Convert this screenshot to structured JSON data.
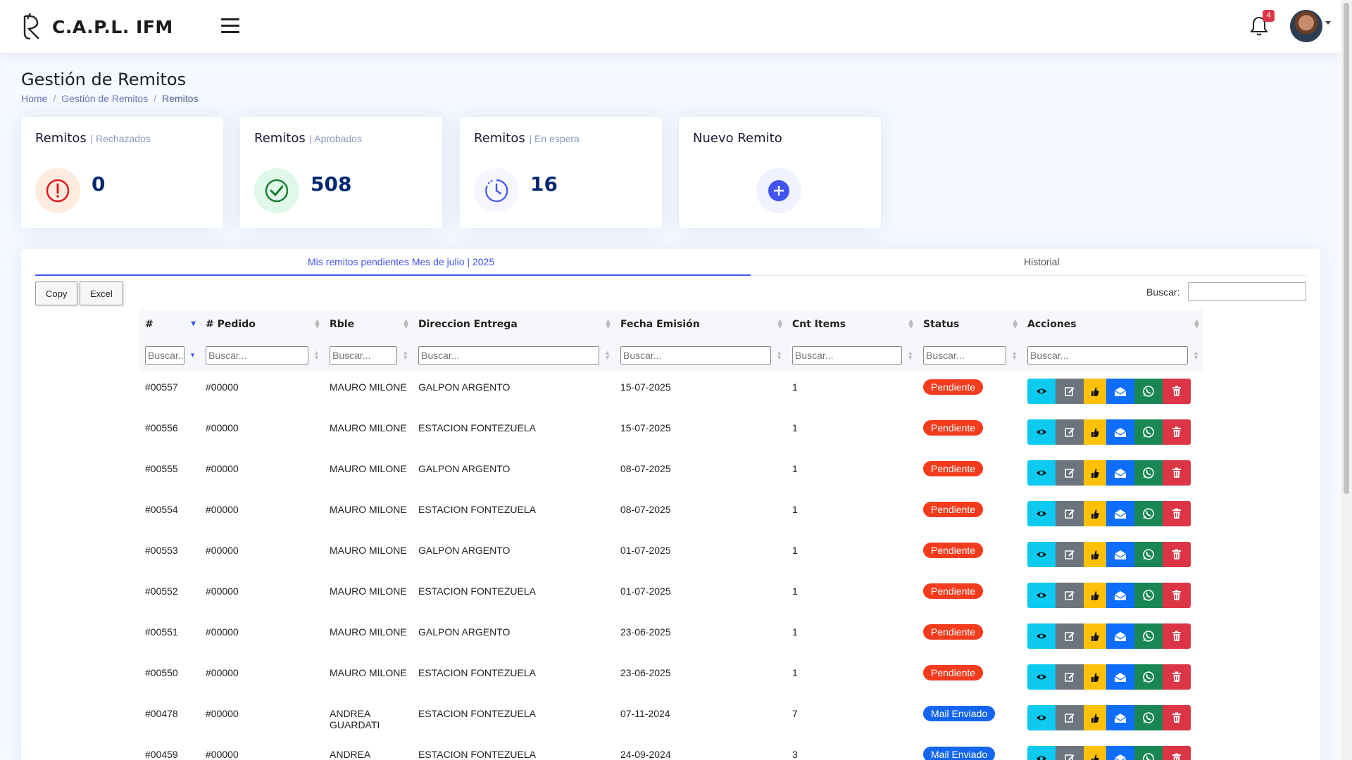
{
  "header": {
    "brand": "C.A.P.L. IFM",
    "notifications_count": "4"
  },
  "page": {
    "title": "Gestión de Remitos",
    "breadcrumb": [
      "Home",
      "Gestión de Remitos",
      "Remitos"
    ]
  },
  "cards": [
    {
      "title": "Remitos",
      "subtitle": "| Rechazados",
      "value": "0",
      "color": "#e4151f"
    },
    {
      "title": "Remitos",
      "subtitle": "| Aprobados",
      "value": "508",
      "color": "#2eca6a"
    },
    {
      "title": "Remitos",
      "subtitle": "| En espera",
      "value": "16",
      "color": "#4154f1"
    },
    {
      "title": "Nuevo Remito",
      "subtitle": "",
      "value": "",
      "color": "#4154f1"
    }
  ],
  "tabs": [
    {
      "label": "Mis remitos pendientes Mes de julio | 2025",
      "active": true
    },
    {
      "label": "Historial",
      "active": false
    }
  ],
  "toolbar": {
    "copy_label": "Copy",
    "excel_label": "Excel",
    "search_label": "Buscar:"
  },
  "table": {
    "columns": [
      "#",
      "# Pedido",
      "Rble",
      "Direccion Entrega",
      "Fecha Emisión",
      "Cnt Items",
      "Status",
      "Acciones"
    ],
    "filter_placeholder": "Buscar...",
    "rows": [
      {
        "id": "#00557",
        "pedido": "#00000",
        "rble": "MAURO MILONE",
        "dir": "GALPON ARGENTO",
        "fecha": "15-07-2025",
        "items": "1",
        "status": "Pendiente"
      },
      {
        "id": "#00556",
        "pedido": "#00000",
        "rble": "MAURO MILONE",
        "dir": "ESTACION FONTEZUELA",
        "fecha": "15-07-2025",
        "items": "1",
        "status": "Pendiente"
      },
      {
        "id": "#00555",
        "pedido": "#00000",
        "rble": "MAURO MILONE",
        "dir": "GALPON ARGENTO",
        "fecha": "08-07-2025",
        "items": "1",
        "status": "Pendiente"
      },
      {
        "id": "#00554",
        "pedido": "#00000",
        "rble": "MAURO MILONE",
        "dir": "ESTACION FONTEZUELA",
        "fecha": "08-07-2025",
        "items": "1",
        "status": "Pendiente"
      },
      {
        "id": "#00553",
        "pedido": "#00000",
        "rble": "MAURO MILONE",
        "dir": "GALPON ARGENTO",
        "fecha": "01-07-2025",
        "items": "1",
        "status": "Pendiente"
      },
      {
        "id": "#00552",
        "pedido": "#00000",
        "rble": "MAURO MILONE",
        "dir": "ESTACION FONTEZUELA",
        "fecha": "01-07-2025",
        "items": "1",
        "status": "Pendiente"
      },
      {
        "id": "#00551",
        "pedido": "#00000",
        "rble": "MAURO MILONE",
        "dir": "GALPON ARGENTO",
        "fecha": "23-06-2025",
        "items": "1",
        "status": "Pendiente"
      },
      {
        "id": "#00550",
        "pedido": "#00000",
        "rble": "MAURO MILONE",
        "dir": "ESTACION FONTEZUELA",
        "fecha": "23-06-2025",
        "items": "1",
        "status": "Pendiente"
      },
      {
        "id": "#00478",
        "pedido": "#00000",
        "rble": "ANDREA GUARDATI",
        "dir": "ESTACION FONTEZUELA",
        "fecha": "07-11-2024",
        "items": "7",
        "status": "Mail Enviado"
      },
      {
        "id": "#00459",
        "pedido": "#00000",
        "rble": "ANDREA",
        "dir": "ESTACION FONTEZUELA",
        "fecha": "24-09-2024",
        "items": "3",
        "status": "Mail Enviado"
      }
    ]
  }
}
